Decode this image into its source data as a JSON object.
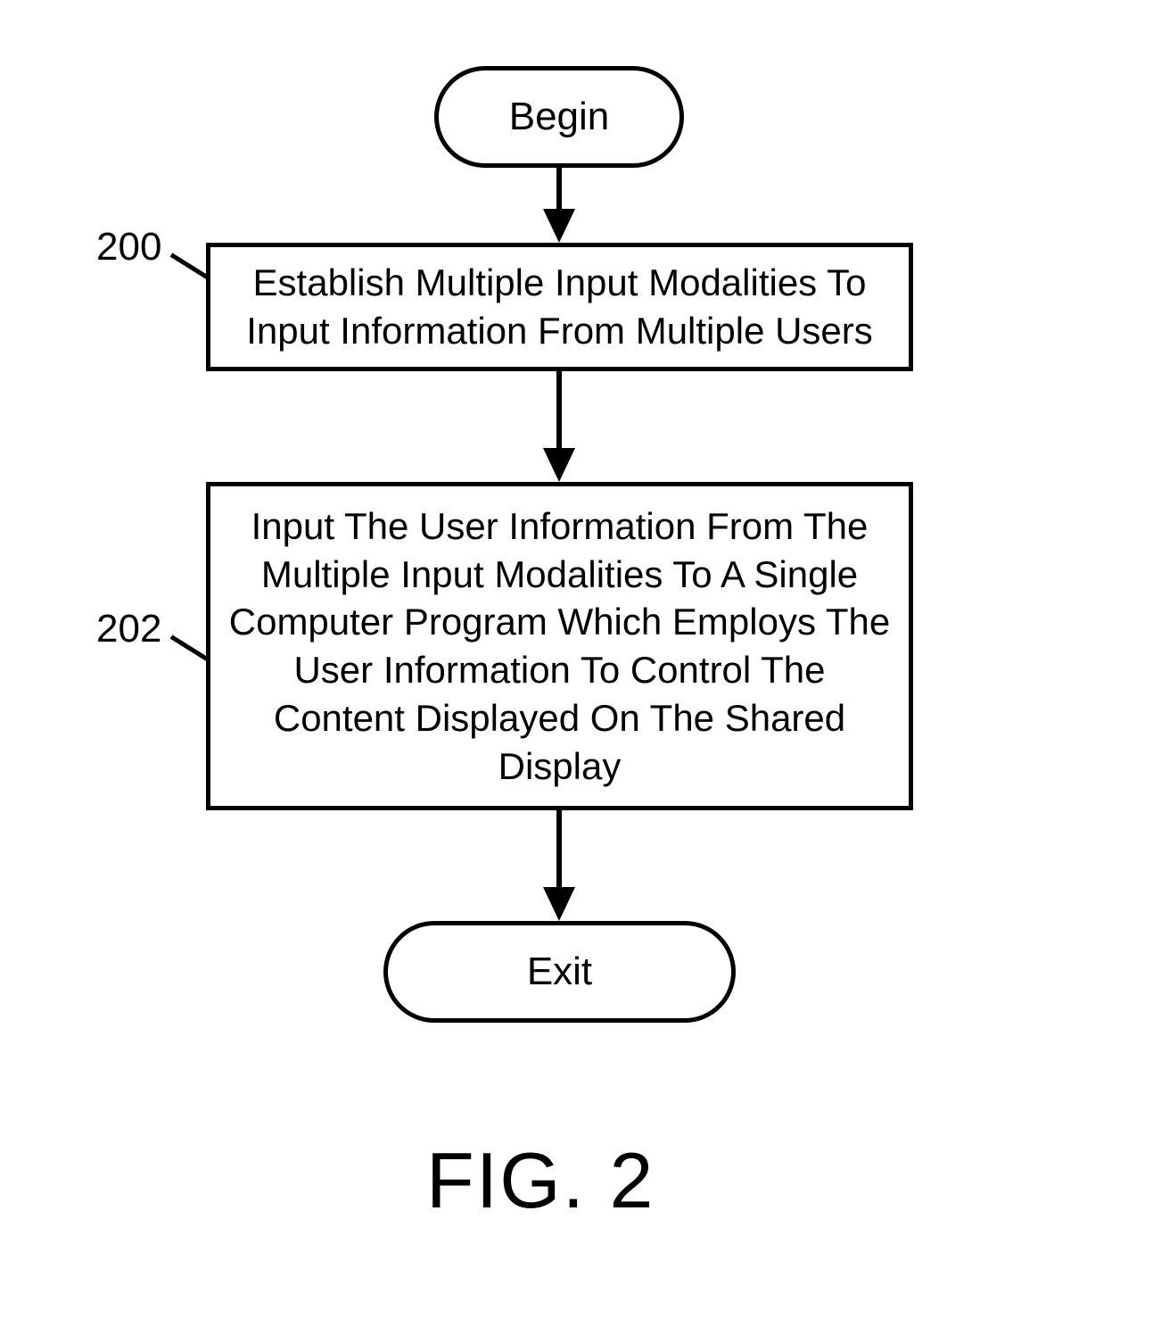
{
  "terminators": {
    "begin": "Begin",
    "exit": "Exit"
  },
  "processes": {
    "step1": "Establish Multiple Input Modalities To Input Information From Multiple Users",
    "step2": "Input The User Information From The Multiple Input Modalities To A Single Computer Program Which Employs The User Information To Control The Content Displayed On The Shared Display"
  },
  "refs": {
    "r200": "200",
    "r202": "202"
  },
  "caption": "FIG. 2",
  "chart_data": {
    "type": "flowchart",
    "nodes": [
      {
        "id": "begin",
        "shape": "terminator",
        "label": "Begin"
      },
      {
        "id": "step1",
        "shape": "process",
        "ref": "200",
        "label": "Establish Multiple Input Modalities To Input Information From Multiple Users"
      },
      {
        "id": "step2",
        "shape": "process",
        "ref": "202",
        "label": "Input The User Information From The Multiple Input Modalities To A Single Computer Program Which Employs The User Information To Control The Content Displayed On The Shared Display"
      },
      {
        "id": "exit",
        "shape": "terminator",
        "label": "Exit"
      }
    ],
    "edges": [
      {
        "from": "begin",
        "to": "step1"
      },
      {
        "from": "step1",
        "to": "step2"
      },
      {
        "from": "step2",
        "to": "exit"
      }
    ],
    "caption": "FIG. 2"
  }
}
